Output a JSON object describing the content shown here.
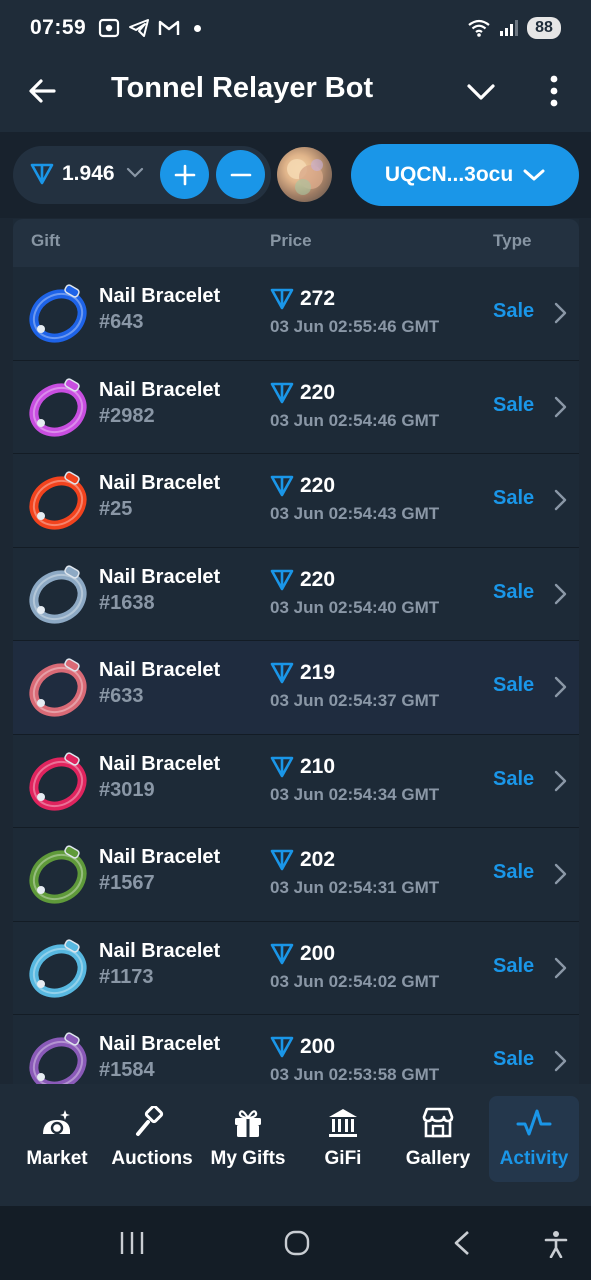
{
  "status_bar": {
    "time": "07:59",
    "battery": "88",
    "icons": [
      "screenshot-icon",
      "telegram-icon",
      "gmail-icon",
      "notification-dot",
      "wifi-icon",
      "signal-icon",
      "battery-icon"
    ]
  },
  "header": {
    "title": "Tonnel Relayer Bot",
    "icons": [
      "back-arrow-icon",
      "chevron-down-icon",
      "more-vertical-icon"
    ]
  },
  "wallet": {
    "balance": "1.946",
    "address": "UQCN...3ocu",
    "icons": [
      "ton-icon",
      "plus-icon",
      "minus-icon",
      "chevron-down-icon"
    ]
  },
  "table": {
    "columns": [
      "Gift",
      "Price",
      "Type"
    ],
    "rows": [
      {
        "name": "Nail Bracelet",
        "number": "#643",
        "price": "272",
        "date": "03 Jun 02:55:46 GMT",
        "type": "Sale",
        "color": "#1e63e8"
      },
      {
        "name": "Nail Bracelet",
        "number": "#2982",
        "price": "220",
        "date": "03 Jun 02:54:46 GMT",
        "type": "Sale",
        "color": "#c84ee0"
      },
      {
        "name": "Nail Bracelet",
        "number": "#25",
        "price": "220",
        "date": "03 Jun 02:54:43 GMT",
        "type": "Sale",
        "color": "#f2431e"
      },
      {
        "name": "Nail Bracelet",
        "number": "#1638",
        "price": "220",
        "date": "03 Jun 02:54:40 GMT",
        "type": "Sale",
        "color": "#8da9c4"
      },
      {
        "name": "Nail Bracelet",
        "number": "#633",
        "price": "219",
        "date": "03 Jun 02:54:37 GMT",
        "type": "Sale",
        "color": "#d96a76"
      },
      {
        "name": "Nail Bracelet",
        "number": "#3019",
        "price": "210",
        "date": "03 Jun 02:54:34 GMT",
        "type": "Sale",
        "color": "#e0245e"
      },
      {
        "name": "Nail Bracelet",
        "number": "#1567",
        "price": "202",
        "date": "03 Jun 02:54:31 GMT",
        "type": "Sale",
        "color": "#5f9a3a"
      },
      {
        "name": "Nail Bracelet",
        "number": "#1173",
        "price": "200",
        "date": "03 Jun 02:54:02 GMT",
        "type": "Sale",
        "color": "#58b8e0"
      },
      {
        "name": "Nail Bracelet",
        "number": "#1584",
        "price": "200",
        "date": "03 Jun 02:53:58 GMT",
        "type": "Sale",
        "color": "#8a5ab8"
      }
    ]
  },
  "bottom_nav": {
    "items": [
      {
        "label": "Market",
        "icon": "market-icon"
      },
      {
        "label": "Auctions",
        "icon": "gavel-icon"
      },
      {
        "label": "My Gifts",
        "icon": "gift-icon"
      },
      {
        "label": "GiFi",
        "icon": "bank-icon"
      },
      {
        "label": "Gallery",
        "icon": "store-icon"
      },
      {
        "label": "Activity",
        "icon": "activity-icon",
        "active": true
      }
    ]
  },
  "system_nav": {
    "icons": [
      "recents-icon",
      "home-icon",
      "back-icon",
      "accessibility-icon"
    ]
  },
  "colors": {
    "accent": "#1a96e8",
    "background": "#1c2733",
    "row_highlight": "#1f2c3f"
  }
}
